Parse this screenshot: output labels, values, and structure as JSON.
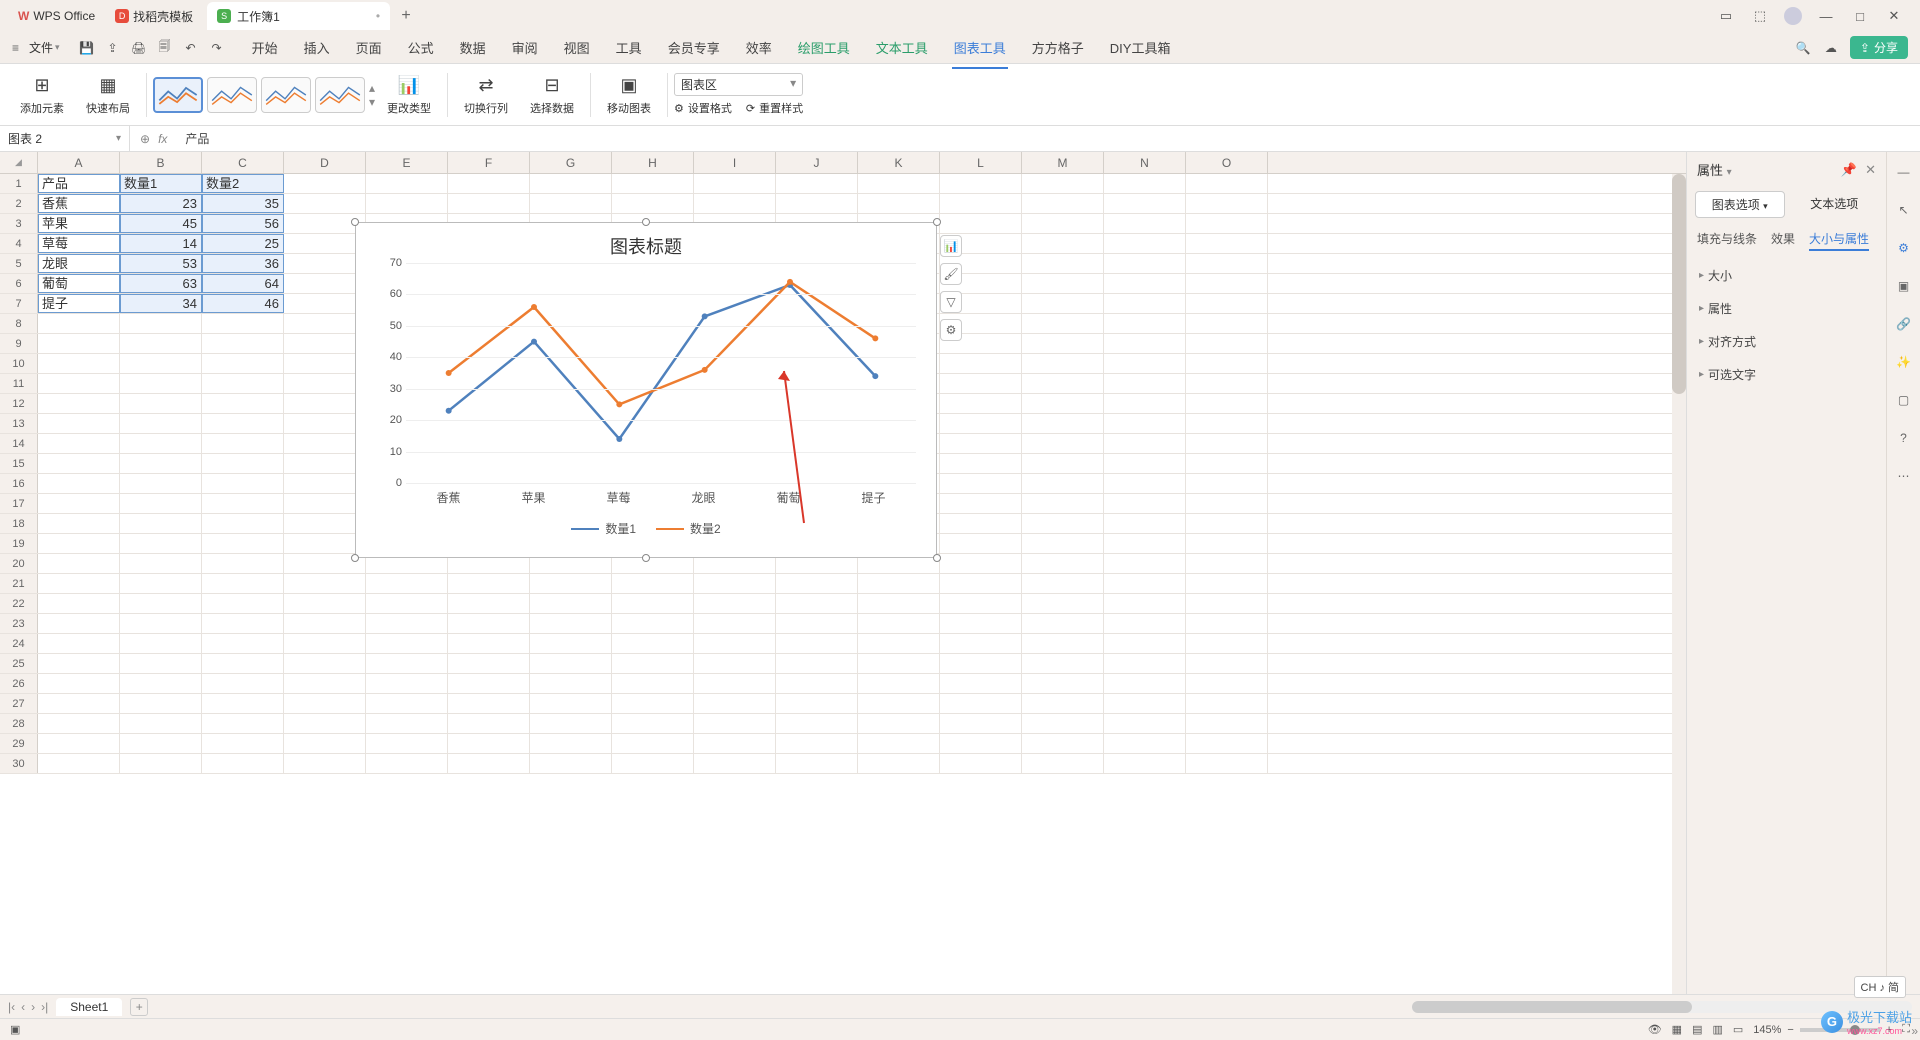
{
  "titlebar": {
    "app_name": "WPS Office",
    "second_tab": "找稻壳模板",
    "doc_tab": "工作簿1",
    "doc_badge": "S"
  },
  "file_menu": "文件",
  "menu_tabs": [
    "开始",
    "插入",
    "页面",
    "公式",
    "数据",
    "审阅",
    "视图",
    "工具",
    "会员专享",
    "效率",
    "绘图工具",
    "文本工具",
    "图表工具",
    "方方格子",
    "DIY工具箱"
  ],
  "menu_active_index": 12,
  "share_label": "分享",
  "ribbon": {
    "add_element": "添加元素",
    "quick_layout": "快速布局",
    "change_type": "更改类型",
    "switch_rc": "切换行列",
    "select_data": "选择数据",
    "move_chart": "移动图表",
    "area_select": "图表区",
    "set_format": "设置格式",
    "reset_style": "重置样式"
  },
  "namebox": "图表 2",
  "formula": "产品",
  "columns": [
    "A",
    "B",
    "C",
    "D",
    "E",
    "F",
    "G",
    "H",
    "I",
    "J",
    "K",
    "L",
    "M",
    "N",
    "O"
  ],
  "row_count": 30,
  "table": {
    "headers": [
      "产品",
      "数量1",
      "数量2"
    ],
    "rows": [
      [
        "香蕉",
        "23",
        "35"
      ],
      [
        "苹果",
        "45",
        "56"
      ],
      [
        "草莓",
        "14",
        "25"
      ],
      [
        "龙眼",
        "53",
        "36"
      ],
      [
        "葡萄",
        "63",
        "64"
      ],
      [
        "提子",
        "34",
        "46"
      ]
    ]
  },
  "chart_data": {
    "type": "line",
    "title": "图表标题",
    "categories": [
      "香蕉",
      "苹果",
      "草莓",
      "龙眼",
      "葡萄",
      "提子"
    ],
    "series": [
      {
        "name": "数量1",
        "color": "#4f81bd",
        "values": [
          23,
          45,
          14,
          53,
          63,
          34
        ]
      },
      {
        "name": "数量2",
        "color": "#ed7d31",
        "values": [
          35,
          56,
          25,
          36,
          64,
          46
        ]
      }
    ],
    "ylim": [
      0,
      70
    ],
    "ytick": 10,
    "xlabel": "",
    "ylabel": ""
  },
  "prop": {
    "title": "属性",
    "tab_chart": "图表选项",
    "tab_text": "文本选项",
    "sub_fill": "填充与线条",
    "sub_effect": "效果",
    "sub_size": "大小与属性",
    "sections": [
      "大小",
      "属性",
      "对齐方式",
      "可选文字"
    ]
  },
  "sheet": {
    "name": "Sheet1"
  },
  "status": {
    "zoom": "145%"
  },
  "ime": "CH ♪ 简",
  "watermark": {
    "name": "极光下载站",
    "url": "www.xz7.com"
  }
}
